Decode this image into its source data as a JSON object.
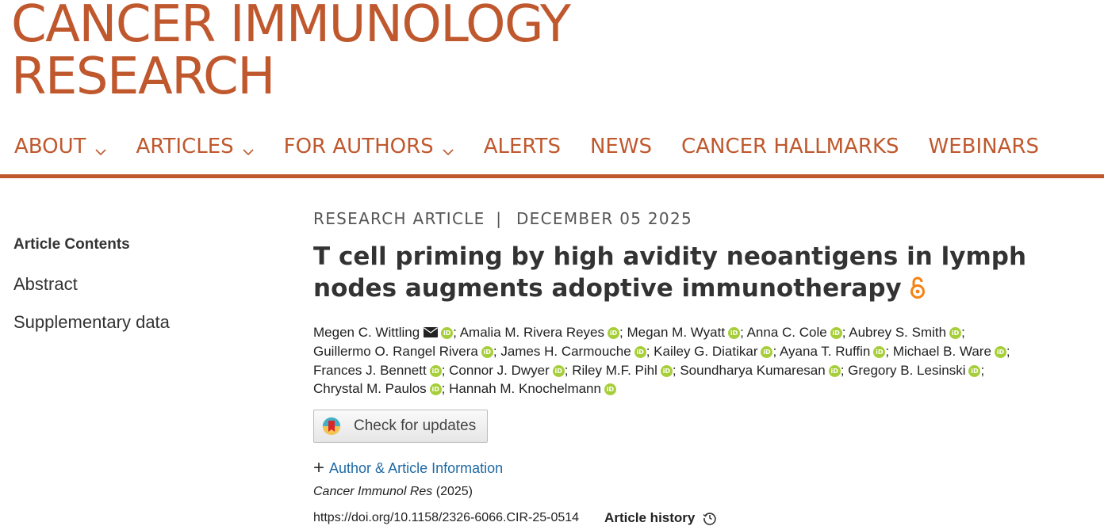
{
  "journal": {
    "line1": "CANCER IMMUNOLOGY",
    "line2": "RESEARCH"
  },
  "nav": {
    "items": [
      {
        "label": "ABOUT",
        "dropdown": true
      },
      {
        "label": "ARTICLES",
        "dropdown": true
      },
      {
        "label": "FOR AUTHORS",
        "dropdown": true
      },
      {
        "label": "ALERTS",
        "dropdown": false
      },
      {
        "label": "NEWS",
        "dropdown": false
      },
      {
        "label": "CANCER HALLMARKS",
        "dropdown": false
      },
      {
        "label": "WEBINARS",
        "dropdown": false
      }
    ]
  },
  "sidebar": {
    "title": "Article Contents",
    "links": [
      "Abstract",
      "Supplementary data"
    ]
  },
  "article": {
    "type": "RESEARCH ARTICLE",
    "separator": "|",
    "date": "DECEMBER 05 2025",
    "title": "T cell priming by high avidity neoantigens in lymph nodes augments adoptive immunotherapy",
    "authors": [
      {
        "name": "Megen C. Wittling",
        "email": true
      },
      {
        "name": "Amalia M. Rivera Reyes"
      },
      {
        "name": "Megan M. Wyatt"
      },
      {
        "name": "Anna C. Cole"
      },
      {
        "name": "Aubrey S. Smith"
      },
      {
        "name": "Guillermo O. Rangel Rivera"
      },
      {
        "name": "James H. Carmouche"
      },
      {
        "name": "Kailey G. Diatikar"
      },
      {
        "name": "Ayana T. Ruffin"
      },
      {
        "name": "Michael B. Ware"
      },
      {
        "name": "Frances J. Bennett"
      },
      {
        "name": "Connor J. Dwyer"
      },
      {
        "name": "Riley M.F. Pihl"
      },
      {
        "name": "Soundharya Kumaresan"
      },
      {
        "name": "Gregory B. Lesinski"
      },
      {
        "name": "Chrystal M. Paulos"
      },
      {
        "name": "Hannah M. Knochelmann"
      }
    ],
    "orcid_glyph": "iD",
    "check_updates": "Check for updates",
    "author_info": "Author & Article Information",
    "journal_abbrev": "Cancer Immunol Res",
    "year": "(2025)",
    "doi": "https://doi.org/10.1158/2326-6066.CIR-25-0514",
    "history": "Article history"
  },
  "colors": {
    "brand": "#C0582E",
    "link": "#1f6aa5",
    "orcid": "#A6CE39",
    "open_access": "#F68212"
  },
  "icons": {
    "nav_dropdown": "chevron-down-icon",
    "open_access": "open-access-lock-icon",
    "email": "envelope-icon",
    "orcid": "orcid-icon",
    "history": "history-clock-icon",
    "updates": "crossmark-icon"
  }
}
